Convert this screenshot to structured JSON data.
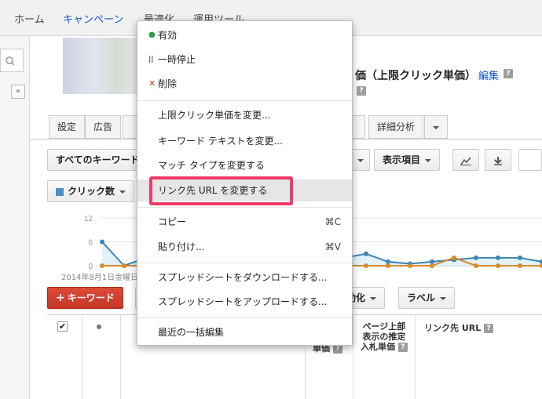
{
  "nav": {
    "home": "ホーム",
    "campaigns": "キャンペーン",
    "optimize": "最適化",
    "tools": "運用ツール"
  },
  "header": {
    "title": "価（上限クリック単価）",
    "edit": "編集",
    "help": "?"
  },
  "tabs": {
    "settings": "設定",
    "ads": "広告",
    "analysis": "詳細分析"
  },
  "toolbar": {
    "all_keywords": "すべてのキーワード",
    "columns": "表示項目",
    "metric": "クリック数",
    "add_keyword": "キーワード",
    "automate": "動化",
    "labels": "ラベル"
  },
  "chart_data": {
    "type": "line",
    "yticks": [
      "12",
      "6",
      "0"
    ],
    "ylim": [
      0,
      12
    ],
    "date_label": "2014年8月1日金曜日",
    "series": [
      {
        "color": "#3a86b4",
        "values": [
          6,
          0,
          2,
          3,
          3,
          3,
          3,
          3,
          3,
          3,
          3,
          2,
          3,
          1,
          0.5,
          1,
          1.5,
          2,
          2,
          2,
          1
        ]
      },
      {
        "color": "#d98a2a",
        "values": [
          0,
          0,
          0,
          0,
          0,
          0,
          0,
          0,
          0,
          0,
          0,
          0,
          0,
          0,
          0,
          0,
          2,
          0,
          0,
          0,
          0
        ]
      }
    ]
  },
  "table": {
    "bid_header": "単価",
    "top_bid_header": [
      "ページ上部",
      "表示の推定",
      "入札単価"
    ],
    "url_header": "リンク先 URL",
    "checkbox": "✔"
  },
  "menu": {
    "enabled": "有効",
    "paused": "一時停止",
    "removed": "削除",
    "change_bid": "上限クリック単価を変更...",
    "change_text": "キーワード テキストを変更...",
    "change_match": "マッチ タイプを変更する",
    "change_url": "リンク先 URL を変更する",
    "copy": "コピー",
    "copy_sc": "⌘C",
    "paste": "貼り付け...",
    "paste_sc": "⌘V",
    "download": "スプレッドシートをダウンロードする...",
    "upload": "スプレッドシートをアップロードする...",
    "recent": "最近の一括編集"
  },
  "colors": {
    "accent_link": "#1155cc",
    "highlight": "#ec3b6b",
    "enabled_dot": "#2e9d4d",
    "removed_x": "#d23f31"
  }
}
